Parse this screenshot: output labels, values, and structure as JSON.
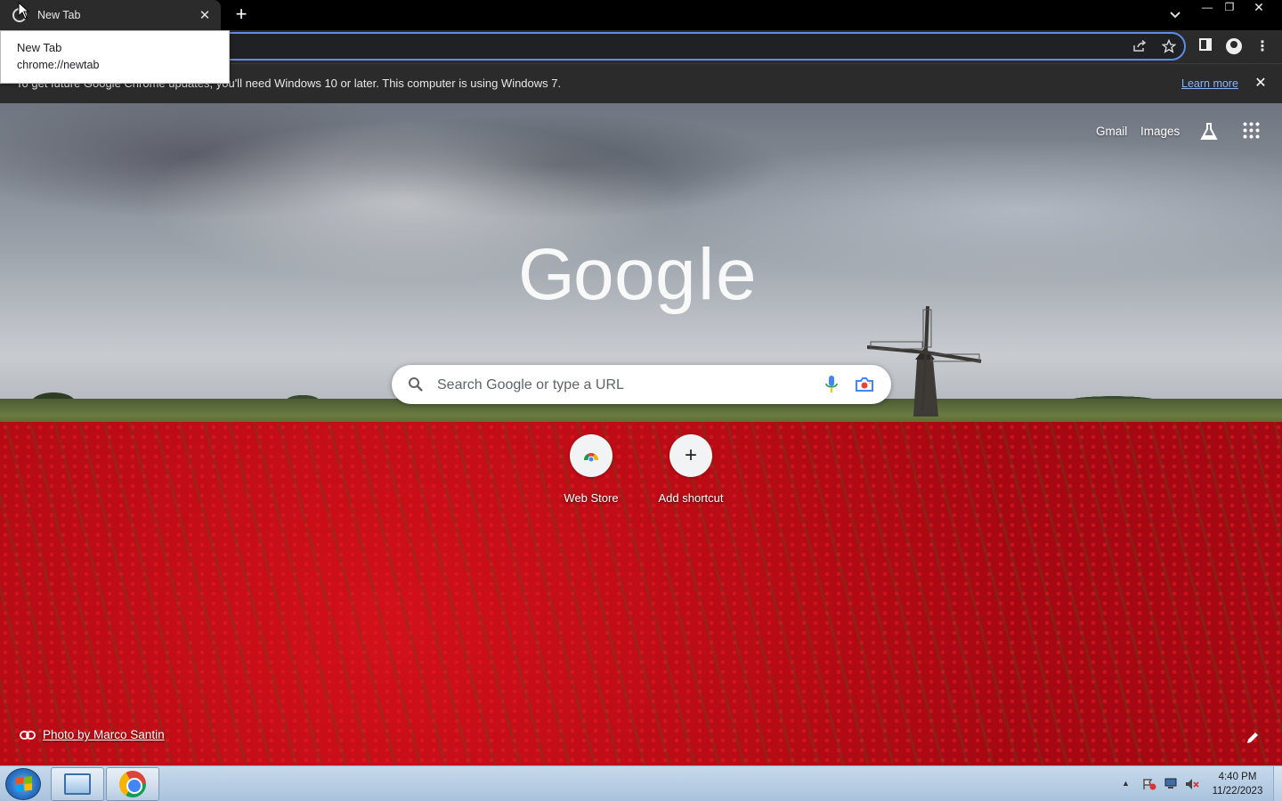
{
  "tab": {
    "title": "New Tab",
    "close": "✕"
  },
  "new_tab_symbol": "+",
  "tooltip": {
    "title": "New Tab",
    "url": "chrome://newtab"
  },
  "window_controls": {
    "minimize": "—",
    "maximize": "❐",
    "close": "✕"
  },
  "infobar": {
    "message": "To get future Google Chrome updates, you'll need Windows 10 or later. This computer is using Windows 7.",
    "learn_more": "Learn more",
    "close": "✕"
  },
  "ntp": {
    "header_links": [
      "Gmail",
      "Images"
    ],
    "search_placeholder": "Search Google or type a URL",
    "shortcuts": [
      {
        "label": "Web Store",
        "icon": "webstore-icon"
      },
      {
        "label": "Add shortcut",
        "icon": "plus-icon",
        "symbol": "+"
      }
    ],
    "attribution": "Photo by Marco Santin",
    "logo_letters": [
      "G",
      "o",
      "o",
      "g",
      "l",
      "e"
    ]
  },
  "taskbar": {
    "tray_arrow": "▲",
    "time": "4:40 PM",
    "date": "11/22/2023"
  },
  "icons": {
    "share": "share-icon",
    "star": "star-icon",
    "menu": "⋮"
  },
  "colors": {
    "omnibox_focus": "#5b8ee6",
    "link_blue": "#8ab4f8",
    "chrome_dark": "#2b2b2b",
    "tulip_red": "#c40d16"
  }
}
